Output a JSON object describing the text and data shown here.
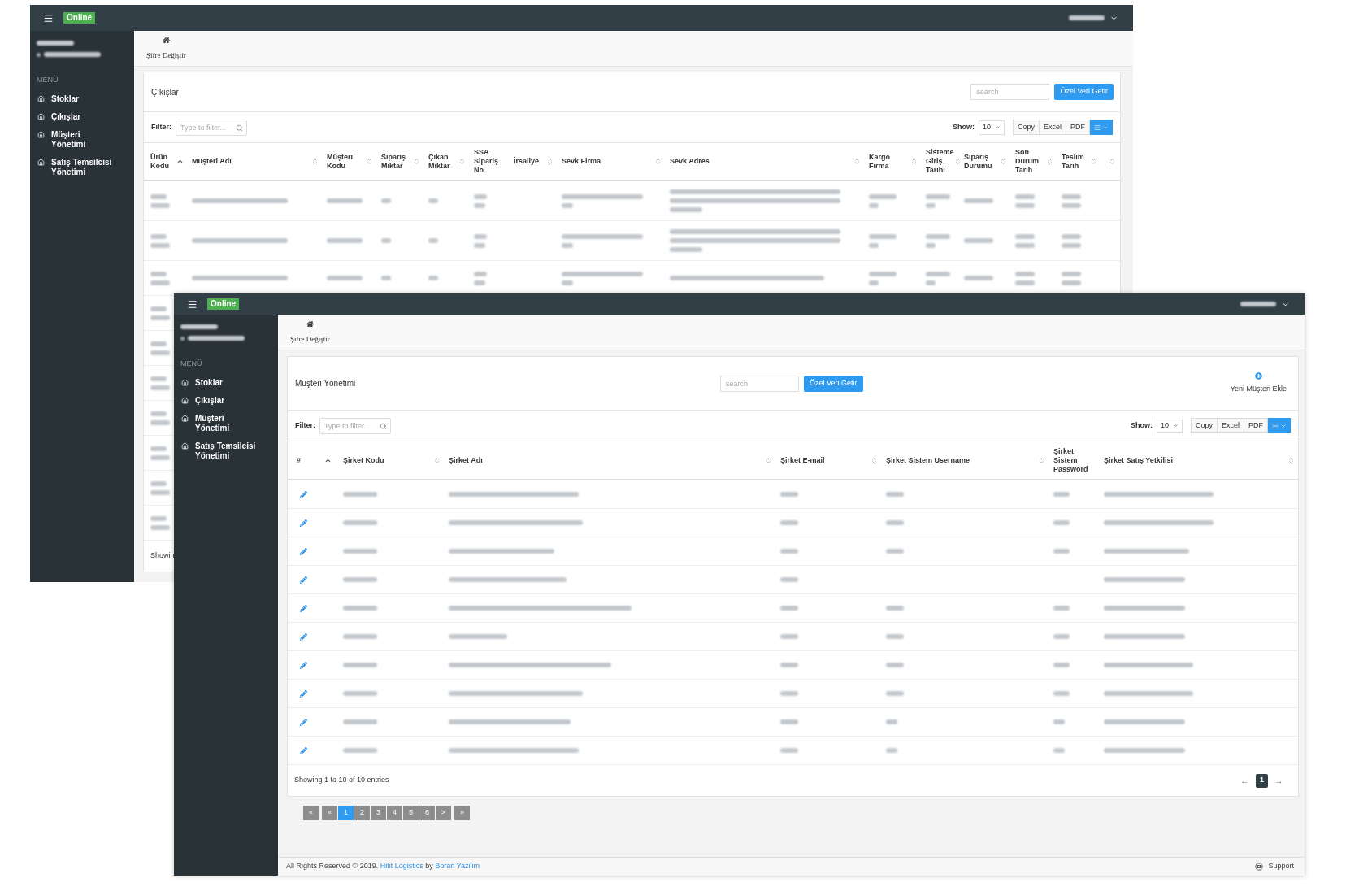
{
  "windows": [
    {
      "status_badge": "Online",
      "breadcrumb_link": "Şifre Değiştir",
      "sidebar": {
        "menu_title": "MENÜ",
        "items": [
          {
            "label": "Stoklar"
          },
          {
            "label": "Çıkışlar"
          },
          {
            "label": "Müşteri Yönetimi"
          },
          {
            "label": "Satış Temsilcisi Yönetimi"
          }
        ]
      },
      "card": {
        "title": "Çıkışlar",
        "search": {
          "placeholder": "search"
        },
        "fetch_button": "Özel Veri Getir",
        "filter": {
          "label": "Filter:",
          "placeholder": "Type to filter..."
        },
        "show": {
          "label": "Show:",
          "value": "10"
        },
        "export_buttons": [
          "Copy",
          "Excel",
          "PDF"
        ],
        "table": {
          "columns": [
            {
              "label": "Ürün Kodu",
              "sortable": true,
              "sorted": true
            },
            {
              "label": "Müşteri Adı",
              "sortable": true,
              "sorted": false
            },
            {
              "label": "Müşteri Kodu",
              "sortable": true,
              "sorted": false
            },
            {
              "label": "Sipariş Miktar",
              "sortable": true,
              "sorted": false
            },
            {
              "label": "Çıkan Miktar",
              "sortable": true,
              "sorted": false
            },
            {
              "label": "SSA Sipariş No",
              "sortable": false,
              "sorted": false
            },
            {
              "label": "İrsaliye",
              "sortable": true,
              "sorted": false
            },
            {
              "label": "Sevk Firma",
              "sortable": true,
              "sorted": false
            },
            {
              "label": "Sevk Adres",
              "sortable": true,
              "sorted": false
            },
            {
              "label": "Kargo Firma",
              "sortable": true,
              "sorted": false
            },
            {
              "label": "Sisteme Giriş Tarihi",
              "sortable": true,
              "sorted": false
            },
            {
              "label": "Sipariş Durumu",
              "sortable": true,
              "sorted": false
            },
            {
              "label": "Son Durum Tarih",
              "sortable": true,
              "sorted": false
            },
            {
              "label": "Teslim Tarih",
              "sortable": true,
              "sorted": false
            }
          ]
        },
        "info": "Showin"
      }
    },
    {
      "status_badge": "Online",
      "breadcrumb_link": "Şifre Değiştir",
      "sidebar": {
        "menu_title": "MENÜ",
        "items": [
          {
            "label": "Stoklar"
          },
          {
            "label": "Çıkışlar"
          },
          {
            "label": "Müşteri Yönetimi"
          },
          {
            "label": "Satış Temsilcisi Yönetimi"
          }
        ]
      },
      "card": {
        "title": "Müşteri Yönetimi",
        "search": {
          "placeholder": "search"
        },
        "fetch_button": "Özel Veri Getir",
        "add_button": "Yeni Müşteri Ekle",
        "filter": {
          "label": "Filter:",
          "placeholder": "Type to filter..."
        },
        "show": {
          "label": "Show:",
          "value": "10"
        },
        "export_buttons": [
          "Copy",
          "Excel",
          "PDF"
        ],
        "table": {
          "columns": [
            {
              "label": "#",
              "sortable": true,
              "sorted": true
            },
            {
              "label": "Şirket Kodu",
              "sortable": true,
              "sorted": false
            },
            {
              "label": "Şirket Adı",
              "sortable": true,
              "sorted": false
            },
            {
              "label": "Şirket E-mail",
              "sortable": true,
              "sorted": false
            },
            {
              "label": "Şirket Sistem Username",
              "sortable": true,
              "sorted": false
            },
            {
              "label": "Şirket Sistem Password",
              "sortable": false,
              "sorted": false
            },
            {
              "label": "Şirket Satış Yetkilisi",
              "sortable": true,
              "sorted": false
            }
          ]
        },
        "info": "Showing 1 to 10 of 10 entries",
        "pager": [
          {
            "label": "←",
            "kind": "arrow",
            "selected": false
          },
          {
            "label": "1",
            "kind": "page",
            "selected": true
          },
          {
            "label": "→",
            "kind": "arrow",
            "selected": false
          }
        ]
      },
      "pagination": [
        {
          "label": "«",
          "selected": false
        },
        {
          "label": "«",
          "selected": false
        },
        {
          "label": "1",
          "selected": true
        },
        {
          "label": "2",
          "selected": false
        },
        {
          "label": "3",
          "selected": false
        },
        {
          "label": "4",
          "selected": false
        },
        {
          "label": "5",
          "selected": false
        },
        {
          "label": "6",
          "selected": false
        },
        {
          "label": ">",
          "selected": false
        },
        {
          "label": "»",
          "selected": false
        }
      ],
      "footer": {
        "text": "All Rights Reserved © 2019.",
        "link_1": "Hitit Logistics",
        "middle": "by",
        "link_2": "Boran Yazilim",
        "support": "Support"
      }
    }
  ]
}
